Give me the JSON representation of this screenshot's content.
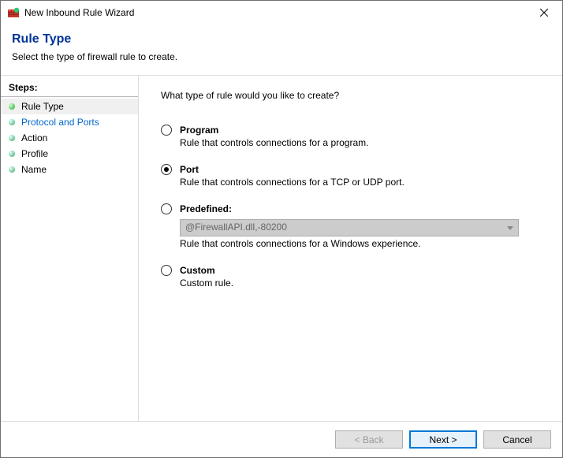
{
  "window": {
    "title": "New Inbound Rule Wizard",
    "close_tooltip": "Close"
  },
  "header": {
    "title": "Rule Type",
    "subtitle": "Select the type of firewall rule to create."
  },
  "sidebar": {
    "heading": "Steps:",
    "items": [
      {
        "label": "Rule Type",
        "current": true,
        "link": false
      },
      {
        "label": "Protocol and Ports",
        "current": false,
        "link": true
      },
      {
        "label": "Action",
        "current": false,
        "link": false
      },
      {
        "label": "Profile",
        "current": false,
        "link": false
      },
      {
        "label": "Name",
        "current": false,
        "link": false
      }
    ]
  },
  "main": {
    "prompt": "What type of rule would you like to create?",
    "options": {
      "program": {
        "label": "Program",
        "description": "Rule that controls connections for a program.",
        "selected": false
      },
      "port": {
        "label": "Port",
        "description": "Rule that controls connections for a TCP or UDP port.",
        "selected": true
      },
      "predefined": {
        "label": "Predefined:",
        "combo_value": "@FirewallAPI.dll,-80200",
        "description": "Rule that controls connections for a Windows experience.",
        "selected": false,
        "combo_enabled": false
      },
      "custom": {
        "label": "Custom",
        "description": "Custom rule.",
        "selected": false
      }
    }
  },
  "footer": {
    "back": "< Back",
    "back_enabled": false,
    "next": "Next >",
    "cancel": "Cancel"
  }
}
